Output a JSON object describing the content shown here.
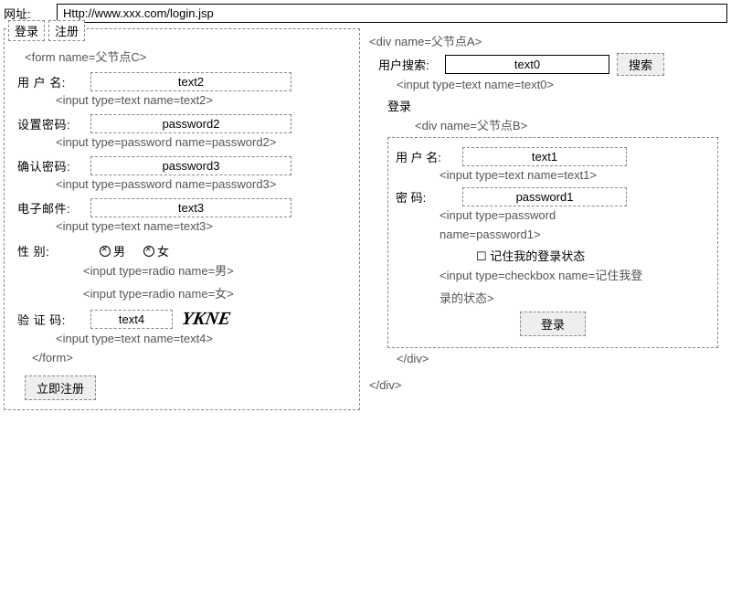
{
  "url": {
    "label": "网址:",
    "value": "Http://www.xxx.com/login.jsp"
  },
  "left": {
    "tabs": [
      "登录",
      "注册"
    ],
    "form_open": "<form name=父节点C>",
    "form_close": "</form>",
    "username": {
      "label": "用 户 名:",
      "value": "text2",
      "annot": "<input type=text name=text2>"
    },
    "setpwd": {
      "label": "设置密码:",
      "value": "password2",
      "annot": "<input type=password name=password2>"
    },
    "confirmpwd": {
      "label": "确认密码:",
      "value": "password3",
      "annot": "<input type=password name=password3>"
    },
    "email": {
      "label": "电子邮件:",
      "value": "text3",
      "annot": "<input type=text name=text3>"
    },
    "gender": {
      "label": "性    别:",
      "male": "男",
      "female": "女",
      "annot_m": "<input type=radio name=男>",
      "annot_f": "<input type=radio name=女>"
    },
    "captcha": {
      "label": "验 证 码:",
      "value": "text4",
      "img_text": "YKNE",
      "annot": "<input type=text name=text4>"
    },
    "submit": "立即注册"
  },
  "right": {
    "div_open": "<div name=父节点A>",
    "div_close": "</div>",
    "search": {
      "label": "用户搜索:",
      "value": "text0",
      "button": "搜索",
      "annot": "<input type=text name=text0>"
    },
    "login_title": "登录",
    "inner_open": "<div name=父节点B>",
    "inner_close": "</div>",
    "username": {
      "label": "用 户 名:",
      "value": "text1",
      "annot": "<input type=text name=text1>"
    },
    "password": {
      "label": "密    码:",
      "value": "password1",
      "annot1": "<input type=password",
      "annot2": "name=password1>"
    },
    "remember": {
      "text": "记住我的登录状态",
      "annot1": "<input type=checkbox name=记住我登",
      "annot2": "录的状态>"
    },
    "login_btn": "登录"
  }
}
